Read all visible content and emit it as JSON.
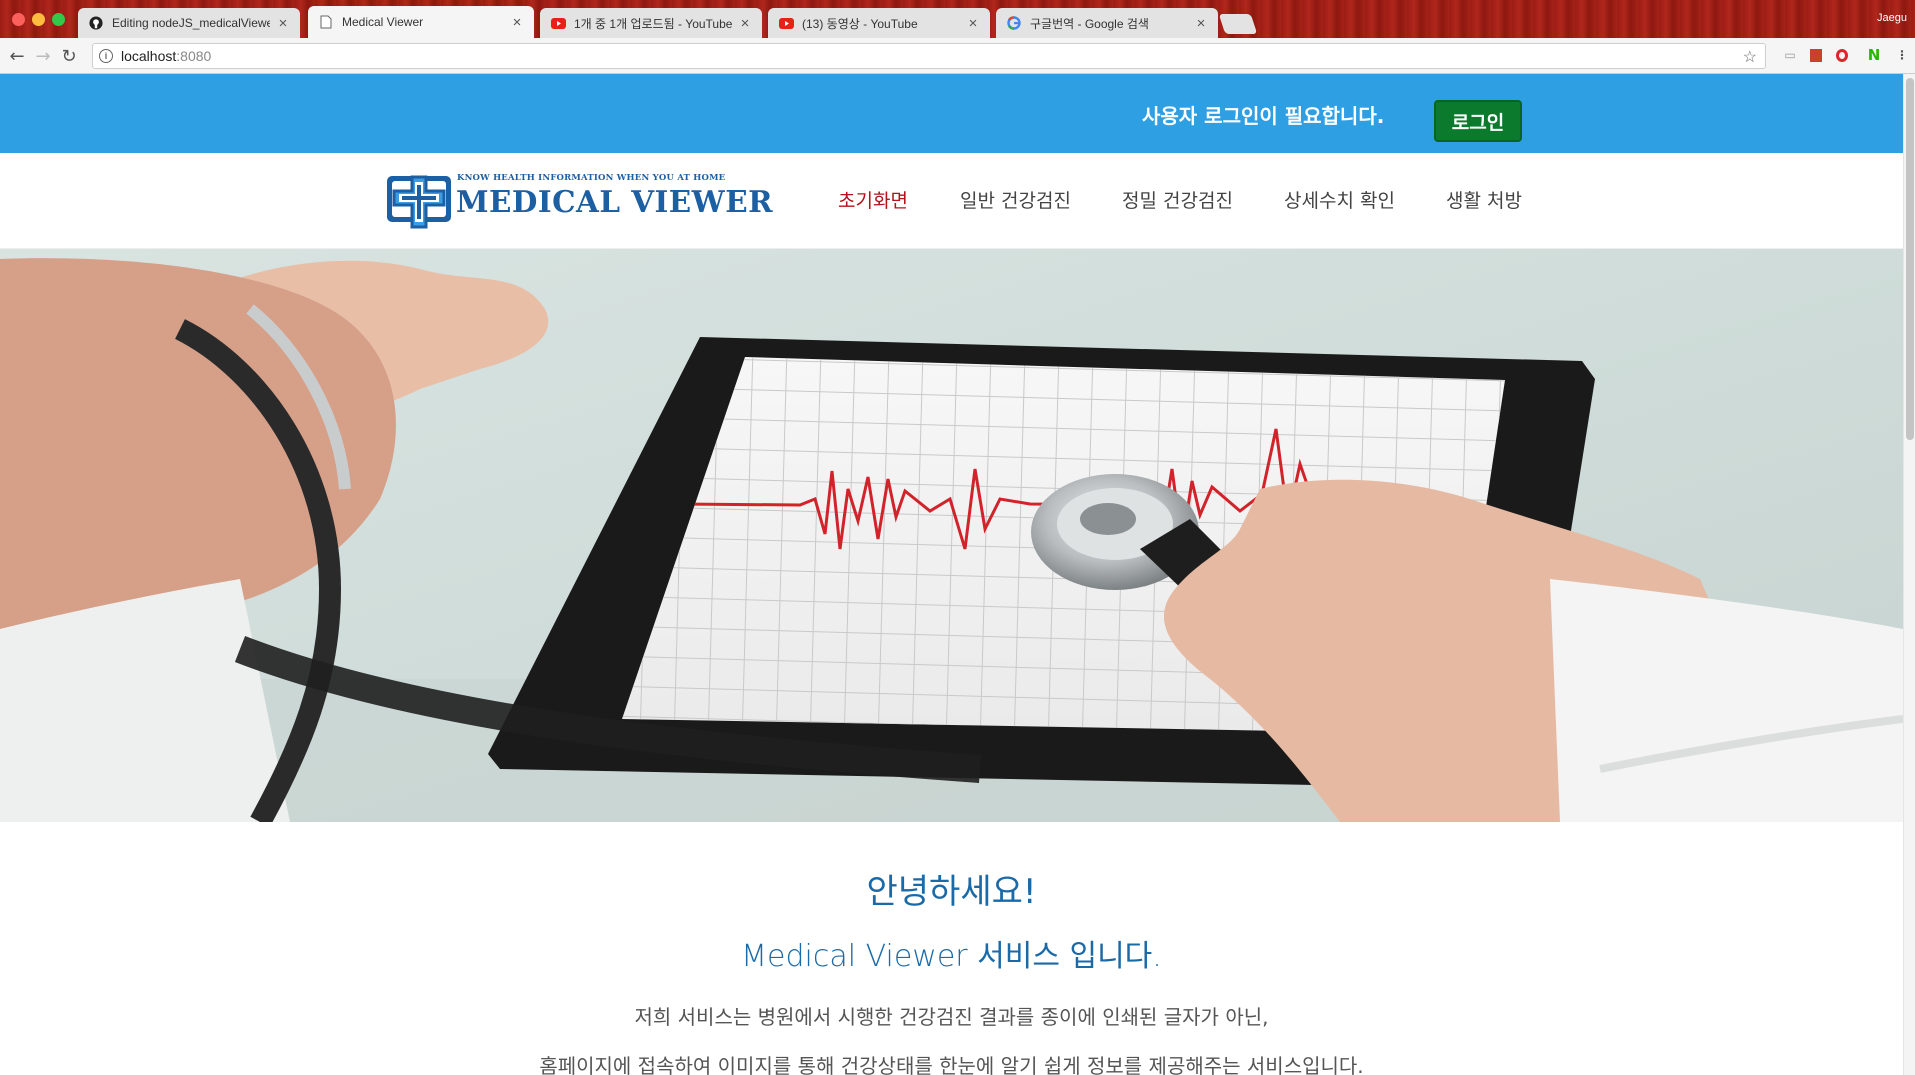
{
  "browser": {
    "tabs": [
      {
        "title": "Editing nodeJS_medicalViewer",
        "icon": "github-icon",
        "active": false
      },
      {
        "title": "Medical Viewer",
        "icon": "page-icon",
        "active": true
      },
      {
        "title": "1개 중 1개 업로드됨 - YouTube",
        "icon": "youtube-icon",
        "active": false
      },
      {
        "title": "(13) 동영상 - YouTube",
        "icon": "youtube-icon",
        "active": false
      },
      {
        "title": "구글번역 - Google 검색",
        "icon": "google-icon",
        "active": false
      }
    ],
    "profile_name": "Jaegu",
    "url_host": "localhost",
    "url_port": ":8080"
  },
  "topbar": {
    "login_message": "사용자 로그인이 필요합니다.",
    "login_button": "로그인"
  },
  "logo": {
    "tagline": "KNOW HEALTH INFORMATION WHEN YOU AT HOME",
    "brand": "MEDICAL VIEWER"
  },
  "nav": {
    "items": [
      {
        "label": "초기화면",
        "active": true
      },
      {
        "label": "일반 건강검진",
        "active": false
      },
      {
        "label": "정밀 건강검진",
        "active": false
      },
      {
        "label": "상세수치 확인",
        "active": false
      },
      {
        "label": "생활 처방",
        "active": false
      }
    ]
  },
  "welcome": {
    "heading": "안녕하세요!",
    "subheading": "Medical Viewer 서비스 입니다.",
    "line1": "저희 서비스는 병원에서 시행한 건강검진 결과를 종이에 인쇄된 글자가 아닌,",
    "line2": "홈페이지에 접속하여 이미지를 통해 건강상태를 한눈에 알기 쉽게 정보를 제공해주는 서비스입니다."
  },
  "colors": {
    "topbar": "#2f9fe3",
    "login_button": "#0b7a2c",
    "nav_active": "#b5121b",
    "welcome_text": "#1b6aa8"
  }
}
